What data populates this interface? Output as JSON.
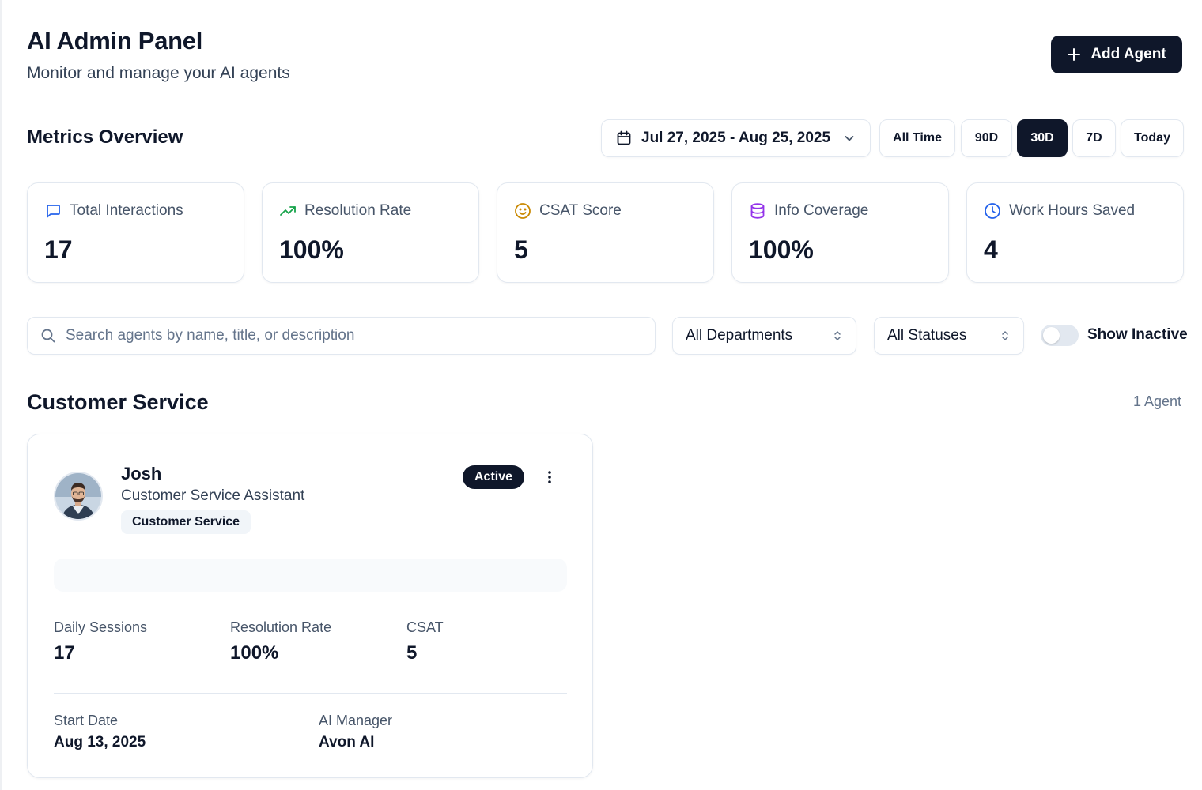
{
  "header": {
    "title": "AI Admin Panel",
    "subtitle": "Monitor and manage your AI agents",
    "add_button": "Add Agent"
  },
  "metrics": {
    "section_title": "Metrics Overview",
    "date_range": "Jul 27, 2025 - Aug 25, 2025",
    "ranges": [
      {
        "label": "All Time",
        "active": false
      },
      {
        "label": "90D",
        "active": false
      },
      {
        "label": "30D",
        "active": true
      },
      {
        "label": "7D",
        "active": false
      },
      {
        "label": "Today",
        "active": false
      }
    ],
    "cards": [
      {
        "label": "Total Interactions",
        "value": "17",
        "icon": "message-icon",
        "color": "#2563eb"
      },
      {
        "label": "Resolution Rate",
        "value": "100%",
        "icon": "trending-up-icon",
        "color": "#16a34a"
      },
      {
        "label": "CSAT Score",
        "value": "5",
        "icon": "smile-icon",
        "color": "#ca8a04"
      },
      {
        "label": "Info Coverage",
        "value": "100%",
        "icon": "database-icon",
        "color": "#9333ea"
      },
      {
        "label": "Work Hours Saved",
        "value": "4",
        "icon": "clock-icon",
        "color": "#2563eb"
      }
    ]
  },
  "filters": {
    "search_placeholder": "Search agents by name, title, or description",
    "department": "All Departments",
    "status": "All Statuses",
    "show_inactive_label": "Show Inactive",
    "show_inactive": false
  },
  "group": {
    "title": "Customer Service",
    "count": "1 Agent"
  },
  "agent": {
    "name": "Josh",
    "title": "Customer Service Assistant",
    "department": "Customer Service",
    "status": "Active",
    "stats": [
      {
        "label": "Daily Sessions",
        "value": "17"
      },
      {
        "label": "Resolution Rate",
        "value": "100%"
      },
      {
        "label": "CSAT",
        "value": "5"
      }
    ],
    "start_date_label": "Start Date",
    "start_date": "Aug 13, 2025",
    "manager_label": "AI Manager",
    "manager": "Avon AI"
  },
  "colors": {
    "primary": "#0f172a",
    "border": "#e2e8f0",
    "muted_text": "#475569"
  }
}
